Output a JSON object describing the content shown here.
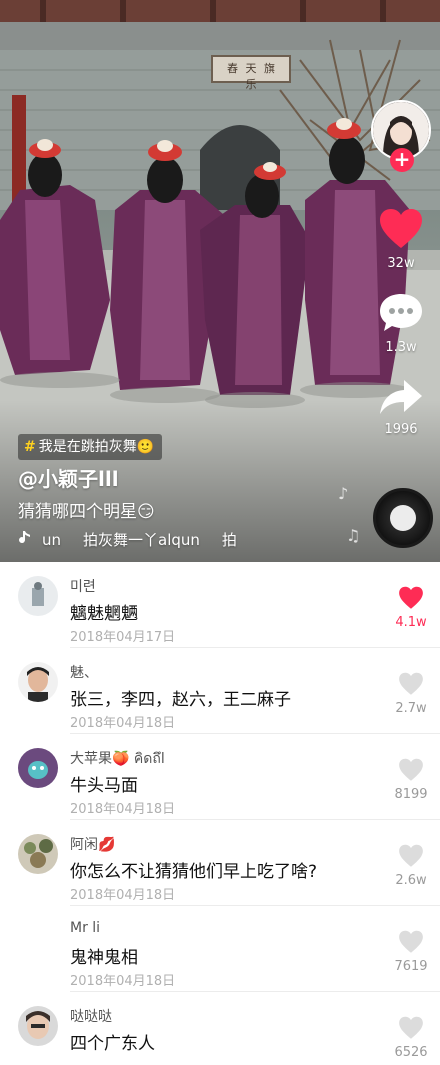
{
  "video": {
    "author_name": "@小颖子lll",
    "caption": "猜猜哪四个明星😏",
    "hashtag": "我是在跳拍灰舞🙂",
    "music": {
      "segments": [
        "un",
        "拍灰舞一丫alqun",
        "拍"
      ]
    },
    "scene_sign": "舂 天 旗 乐",
    "actions": {
      "follow_label": "+",
      "like_count": "32w",
      "comment_count": "1.3w",
      "share_count": "1996"
    },
    "colors": {
      "accent": "#fe2c55",
      "chip": "#ffd21f"
    }
  },
  "comments": [
    {
      "user": "미련",
      "text": "魑魅魍魉",
      "date": "2018年04月17日",
      "likes": "4.1w",
      "liked": true
    },
    {
      "user": "魅、",
      "text": "张三，李四，赵六，王二麻子",
      "date": "2018年04月18日",
      "likes": "2.7w",
      "liked": false
    },
    {
      "user": "大苹果🍑 คิดถึl",
      "text": "牛头马面",
      "date": "2018年04月18日",
      "likes": "8199",
      "liked": false
    },
    {
      "user": "阿闲💋",
      "text": "你怎么不让猜猜他们早上吃了啥?",
      "date": "2018年04月18日",
      "likes": "2.6w",
      "liked": false
    },
    {
      "user": "Mr li",
      "text": "鬼神鬼相",
      "date": "2018年04月18日",
      "likes": "7619",
      "liked": false
    },
    {
      "user": "哒哒哒",
      "text": "四个广东人",
      "date": "",
      "likes": "6526",
      "liked": false
    }
  ]
}
